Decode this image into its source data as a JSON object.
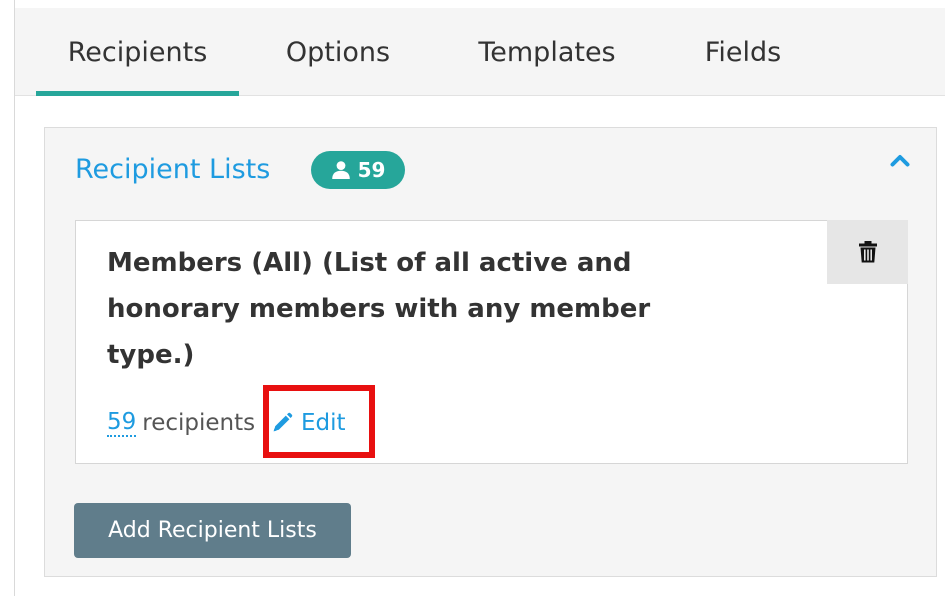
{
  "tabs": [
    {
      "label": "Recipients",
      "active": true
    },
    {
      "label": "Options",
      "active": false
    },
    {
      "label": "Templates",
      "active": false
    },
    {
      "label": "Fields",
      "active": false
    }
  ],
  "panel": {
    "title": "Recipient Lists",
    "count": "59",
    "count_icon": "user-icon",
    "collapse_icon": "chevron-up-icon"
  },
  "card": {
    "title": "Members (All) (List of all active and honorary members with any member type.)",
    "recipient_count": "59",
    "recipient_label": "recipients",
    "edit_label": "Edit",
    "edit_icon": "pencil-icon",
    "delete_icon": "trash-icon"
  },
  "add_button_label": "Add Recipient Lists",
  "colors": {
    "accent": "#26a69a",
    "link": "#1e9be0",
    "button": "#607d8b",
    "highlight": "#e81010"
  }
}
